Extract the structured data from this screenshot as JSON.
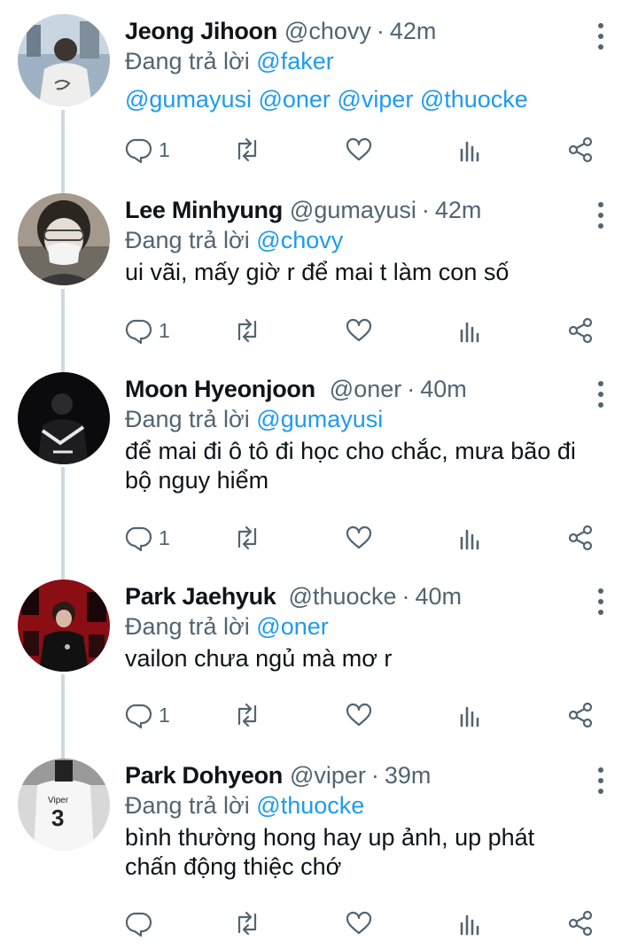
{
  "tweets": [
    {
      "name": "Jeong Jihoon",
      "handle": "@chovy",
      "sep": "·",
      "time": "42m",
      "replying_prefix": "Đang trả lời",
      "replying_to": "@faker",
      "text": "@gumayusi @oner @viper @thuocke",
      "text_is_mention": true,
      "reply_count": "1"
    },
    {
      "name": "Lee Minhyung",
      "handle": "@gumayusi",
      "sep": "·",
      "time": "42m",
      "replying_prefix": "Đang trả lời",
      "replying_to": "@chovy",
      "text": "ui vãi, mấy giờ r để mai t làm con số",
      "text_is_mention": false,
      "reply_count": "1"
    },
    {
      "name": "Moon Hyeonjoon",
      "handle": "@oner",
      "sep": "·",
      "time": "40m",
      "replying_prefix": "Đang trả lời",
      "replying_to": "@gumayusi",
      "text": "để mai đi ô tô đi học cho chắc, mưa bão đi bộ nguy hiểm",
      "text_is_mention": false,
      "reply_count": "1"
    },
    {
      "name": "Park Jaehyuk",
      "handle": "@thuocke",
      "sep": "·",
      "time": "40m",
      "replying_prefix": "Đang trả lời",
      "replying_to": "@oner",
      "text": "vailon chưa ngủ mà mơ r",
      "text_is_mention": false,
      "reply_count": "1"
    },
    {
      "name": "Park Dohyeon",
      "handle": "@viper",
      "sep": "·",
      "time": "39m",
      "replying_prefix": "Đang trả lời",
      "replying_to": "@thuocke",
      "text": "bình thường hong hay up ảnh, up phát chấn động thiệc chớ",
      "text_is_mention": false,
      "reply_count": "",
      "avatar_text": "Viper",
      "avatar_number": "3"
    }
  ],
  "icons": {
    "reply": "reply-icon",
    "retweet": "retweet-icon",
    "like": "like-icon",
    "views": "views-icon",
    "share": "share-icon",
    "more": "more-options-icon"
  },
  "colors": {
    "mention": "#1d9bf0",
    "secondary_text": "#536471",
    "thread_line": "#cfd9de"
  }
}
